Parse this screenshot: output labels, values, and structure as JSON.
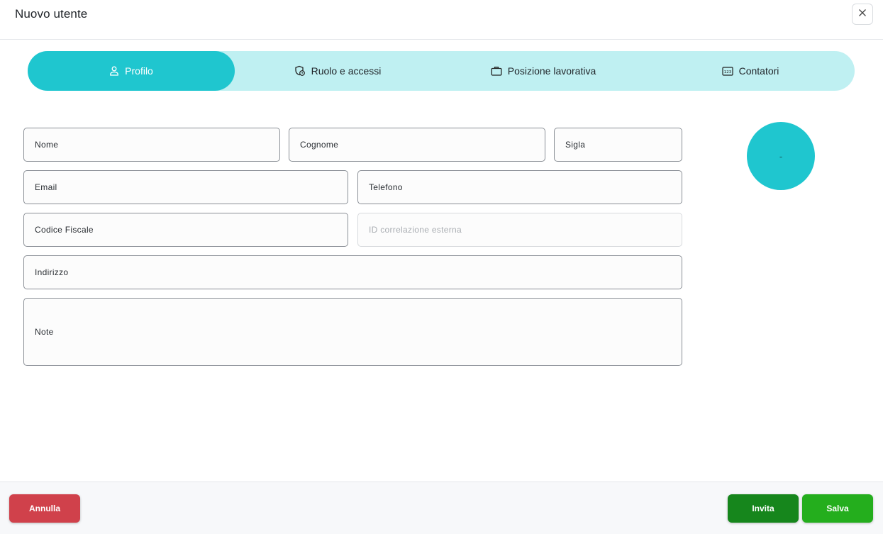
{
  "dialog": {
    "title": "Nuovo utente",
    "close_icon": "close-icon"
  },
  "tabs": [
    {
      "label": "Profilo",
      "icon": "user-icon",
      "active": true
    },
    {
      "label": "Ruolo e accessi",
      "icon": "shield-clock-icon",
      "active": false
    },
    {
      "label": "Posizione lavorativa",
      "icon": "briefcase-icon",
      "active": false
    },
    {
      "label": "Contatori",
      "icon": "counter-123-icon",
      "active": false
    }
  ],
  "form": {
    "nome": "Nome",
    "cognome": "Cognome",
    "sigla": "Sigla",
    "email": "Email",
    "telefono": "Telefono",
    "codice_fiscale": "Codice Fiscale",
    "id_correlazione": "ID correlazione esterna",
    "indirizzo": "Indirizzo",
    "note": "Note"
  },
  "avatar": {
    "initials": "-"
  },
  "footer": {
    "cancel_label": "Annulla",
    "invite_label": "Invita",
    "save_label": "Salva"
  },
  "colors": {
    "accent": "#1fc6cf",
    "tab_bar": "#bff0f2",
    "cancel": "#d0414b",
    "invite": "#16861c",
    "save": "#24ae1d"
  }
}
